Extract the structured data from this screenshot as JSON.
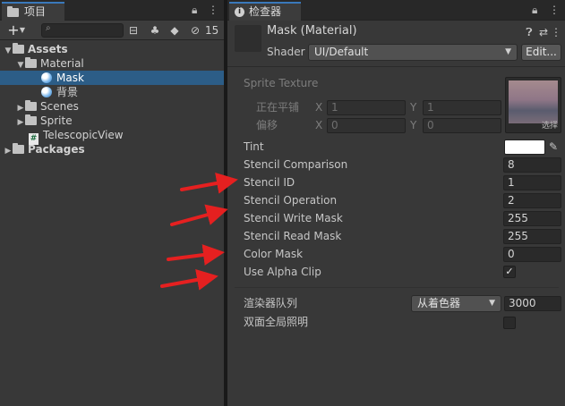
{
  "colors": {
    "accent": "#3a79bb",
    "selection": "#2c5d87",
    "arrow": "#e52020"
  },
  "project": {
    "tab_label": "项目",
    "hidden_count": "15",
    "tree": [
      {
        "label": "Assets",
        "type": "folder",
        "expanded": true,
        "bold": true
      },
      {
        "label": "Material",
        "type": "folder",
        "expanded": true
      },
      {
        "label": "Mask",
        "type": "material",
        "selected": true
      },
      {
        "label": "背景",
        "type": "material"
      },
      {
        "label": "Scenes",
        "type": "folder"
      },
      {
        "label": "Sprite",
        "type": "folder"
      },
      {
        "label": "TelescopicView",
        "type": "script"
      },
      {
        "label": "Packages",
        "type": "folder",
        "bold": true
      }
    ]
  },
  "inspector": {
    "tab_label": "检查器",
    "header_title": "Mask (Material)",
    "shader_label": "Shader",
    "shader_value": "UI/Default",
    "edit_button": "Edit...",
    "sprite_texture_label": "Sprite Texture",
    "tiling_label": "正在平铺",
    "offset_label": "偏移",
    "x_label": "X",
    "y_label": "Y",
    "tiling_x": "1",
    "tiling_y": "1",
    "offset_x": "0",
    "offset_y": "0",
    "select_label": "选择",
    "tint_label": "Tint",
    "properties": [
      {
        "label": "Stencil Comparison",
        "value": "8"
      },
      {
        "label": "Stencil ID",
        "value": "1"
      },
      {
        "label": "Stencil Operation",
        "value": "2"
      },
      {
        "label": "Stencil Write Mask",
        "value": "255"
      },
      {
        "label": "Stencil Read Mask",
        "value": "255"
      },
      {
        "label": "Color Mask",
        "value": "0"
      }
    ],
    "alpha_clip_label": "Use Alpha Clip",
    "alpha_clip_checked": true,
    "render_queue_label": "渲染器队列",
    "render_queue_mode": "从着色器",
    "render_queue_value": "3000",
    "double_sided_gi_label": "双面全局照明",
    "double_sided_gi_checked": false
  }
}
